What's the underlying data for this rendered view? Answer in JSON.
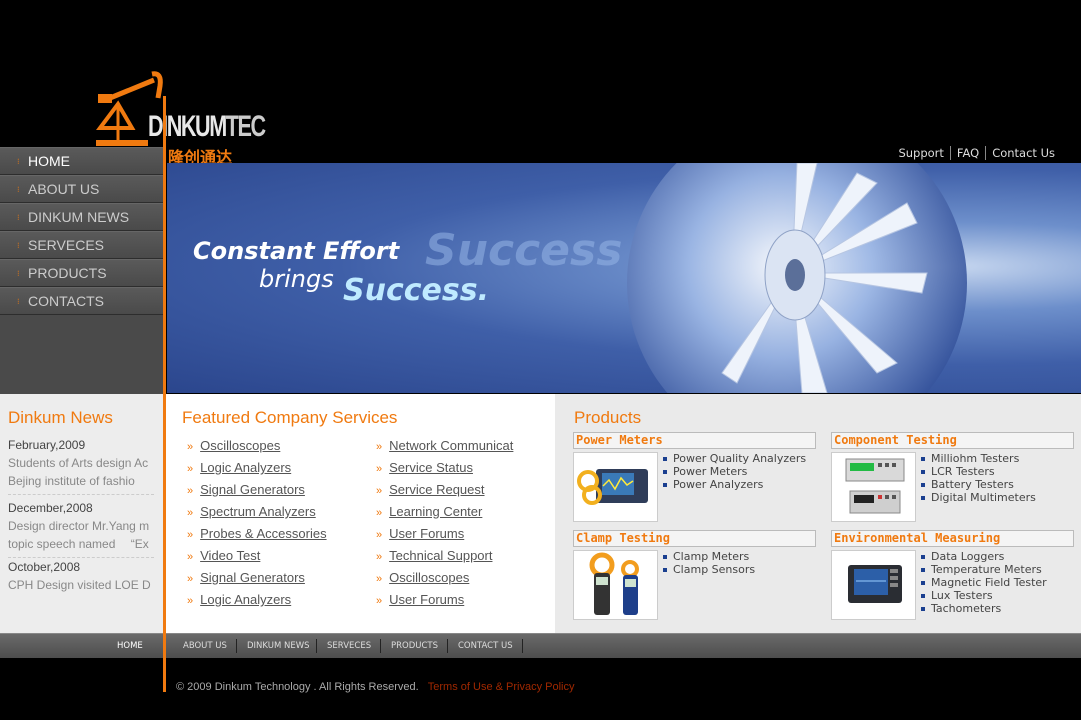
{
  "brand": {
    "name_dinkum": "DINKUM",
    "name_tec": "TEC",
    "name_cn": "隆创通达",
    "accent_color": "#f07a10"
  },
  "top_links": [
    "Support",
    "FAQ",
    "Contact Us"
  ],
  "left_nav": [
    {
      "label": "HOME",
      "active": true
    },
    {
      "label": "ABOUT US",
      "active": false
    },
    {
      "label": "DINKUM NEWS",
      "active": false
    },
    {
      "label": "SERVECES",
      "active": false
    },
    {
      "label": "PRODUCTS",
      "active": false
    },
    {
      "label": "CONTACTS",
      "active": false
    }
  ],
  "banner": {
    "line1": "Constant Effort",
    "line2": "brings",
    "line3": "Success.",
    "ghost": "Success"
  },
  "news": {
    "title": "Dinkum News",
    "items": [
      {
        "date": "February,2009",
        "lines": [
          "Students of Arts design Ac",
          "Bejing institute of fashio"
        ]
      },
      {
        "date": "December,2008",
        "lines": [
          "Design director Mr.Yang m",
          "topic speech named 　“Ex"
        ]
      },
      {
        "date": "October,2008",
        "lines": [
          "CPH Design visited LOE D"
        ]
      }
    ]
  },
  "services": {
    "title": "Featured Company Services",
    "left": [
      "Oscilloscopes ",
      "Logic Analyzers ",
      "Signal Generators ",
      "Spectrum Analyzers ",
      "Probes & Accessories ",
      "Video Test ",
      "Signal Generators ",
      "Logic Analyzers "
    ],
    "right": [
      "Network Communicat",
      "Service Status ",
      "Service Request ",
      "Learning Center ",
      "User Forums ",
      "Technical Support",
      "Oscilloscopes ",
      "User Forums"
    ]
  },
  "products": {
    "title": "Products",
    "boxes": [
      {
        "title": "Power Meters",
        "icon": "power-meter-image",
        "items": [
          "Power Quality Analyzers",
          "Power Meters",
          "Power Analyzers"
        ]
      },
      {
        "title": "Component Testing",
        "icon": "component-tester-image",
        "items": [
          "Milliohm Testers",
          "LCR Testers",
          "Battery Testers",
          "Digital Multimeters"
        ]
      },
      {
        "title": "Clamp Testing",
        "icon": "clamp-meter-image",
        "items": [
          "Clamp Meters",
          "Clamp Sensors"
        ]
      },
      {
        "title": "Environmental Measuring",
        "icon": "data-logger-image",
        "items": [
          "Data Loggers",
          "Temperature Meters",
          "Magnetic Field Tester",
          "Lux Testers",
          "Tachometers"
        ]
      }
    ]
  },
  "bottom_nav": [
    "HOME",
    "ABOUT US",
    "DINKUM NEWS",
    "SERVECES",
    "PRODUCTS",
    "CONTACT US"
  ],
  "footer": {
    "copyright": "© 2009 Dinkum Technology . All Rights Reserved.",
    "policy": "Terms of Use & Privacy Policy"
  }
}
